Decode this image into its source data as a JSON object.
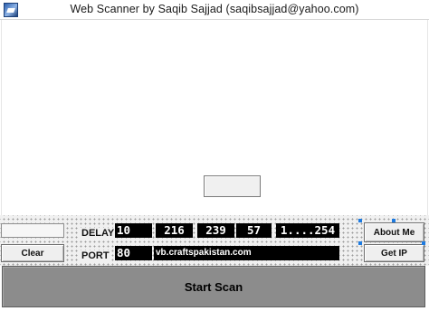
{
  "window": {
    "title": "Web Scanner by Saqib Sajjad  (saqibsajjad@yahoo.com)"
  },
  "controls": {
    "delay_label": "DELAY",
    "delay_value": "10",
    "ip": [
      "216",
      "239",
      "57"
    ],
    "range": "1....254",
    "port_label": "PORT",
    "port_value": "80",
    "host": "vb.craftspakistan.com",
    "clear_button": "Clear",
    "about_button": "About Me",
    "getip_button": "Get IP",
    "start_button": "Start Scan"
  },
  "colors": {
    "field_background": "#000000",
    "field_text": "#ffffff",
    "start_button": "#8c8c8c",
    "selection_handle": "#1e7be0"
  }
}
